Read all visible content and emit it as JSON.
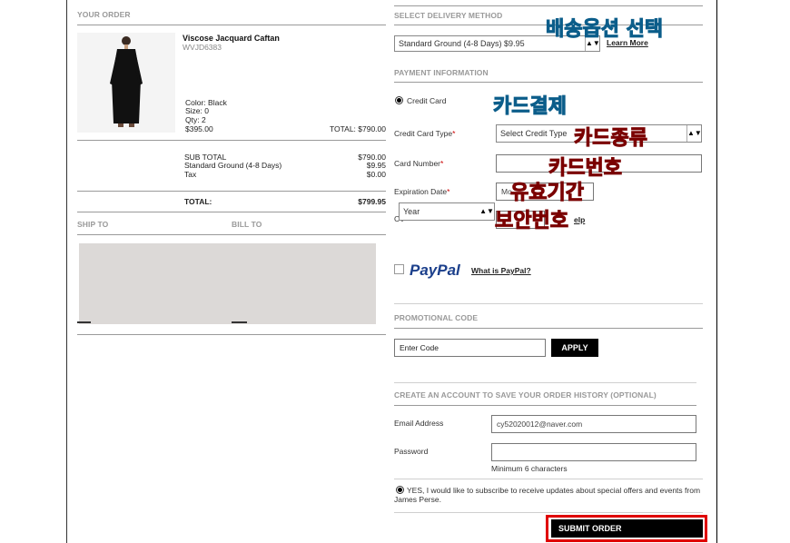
{
  "order": {
    "header": "YOUR ORDER",
    "product_name": "Viscose Jacquard Caftan",
    "product_sku": "WVJD6383",
    "color": "Color: Black",
    "size": "Size: 0",
    "qty": "Qty: 2",
    "unit_price": "$395.00",
    "line_total": "TOTAL: $790.00",
    "subtotal_label": "SUB TOTAL",
    "subtotal_value": "$790.00",
    "shipping_label": "Standard Ground (4-8 Days)",
    "shipping_value": "$9.95",
    "tax_label": "Tax",
    "tax_value": "$0.00",
    "total_label": "TOTAL:",
    "total_value": "$799.95"
  },
  "addresses": {
    "ship_to": "SHIP TO",
    "bill_to": "BILL TO"
  },
  "delivery": {
    "header": "SELECT DELIVERY METHOD",
    "selected": "Standard Ground (4-8 Days) $9.95",
    "learn_more": "Learn More"
  },
  "payment": {
    "header": "PAYMENT INFORMATION",
    "credit_card_option": "Credit Card",
    "card_type_label": "Credit Card Type",
    "card_type_value": "Select Credit Type",
    "card_number_label": "Card Number",
    "expiration_label": "Expiration Date",
    "expiration_month": "Mo",
    "expiration_year": "Year",
    "cvv_label": "CV",
    "cvv_help": "elp",
    "required_mark": "*",
    "paypal_logo": "PayPal",
    "paypal_link": "What is PayPal?"
  },
  "promo": {
    "header": "PROMOTIONAL CODE",
    "value": "Enter Code",
    "apply": "APPLY"
  },
  "account": {
    "header": "CREATE AN ACCOUNT TO SAVE YOUR ORDER HISTORY (OPTIONAL)",
    "email_label": "Email Address",
    "email_value": "cy52020012@naver.com",
    "password_label": "Password",
    "password_hint": "Minimum 6 characters",
    "subscribe_text": "YES, I would like to subscribe to receive updates about special offers and events from James Perse."
  },
  "submit": "SUBMIT ORDER",
  "annotations": {
    "delivery": "배송옵션 선택",
    "card_payment": "카드결제",
    "card_type": "카드종류",
    "card_number": "카드번호",
    "expiry": "유효기간",
    "cvv": "보안번호"
  },
  "colors": {
    "annotation_blue": "#27a9e1",
    "annotation_red": "#e2231a",
    "submit_highlight": "#e00000",
    "paypal_blue": "#1b3f8b"
  }
}
